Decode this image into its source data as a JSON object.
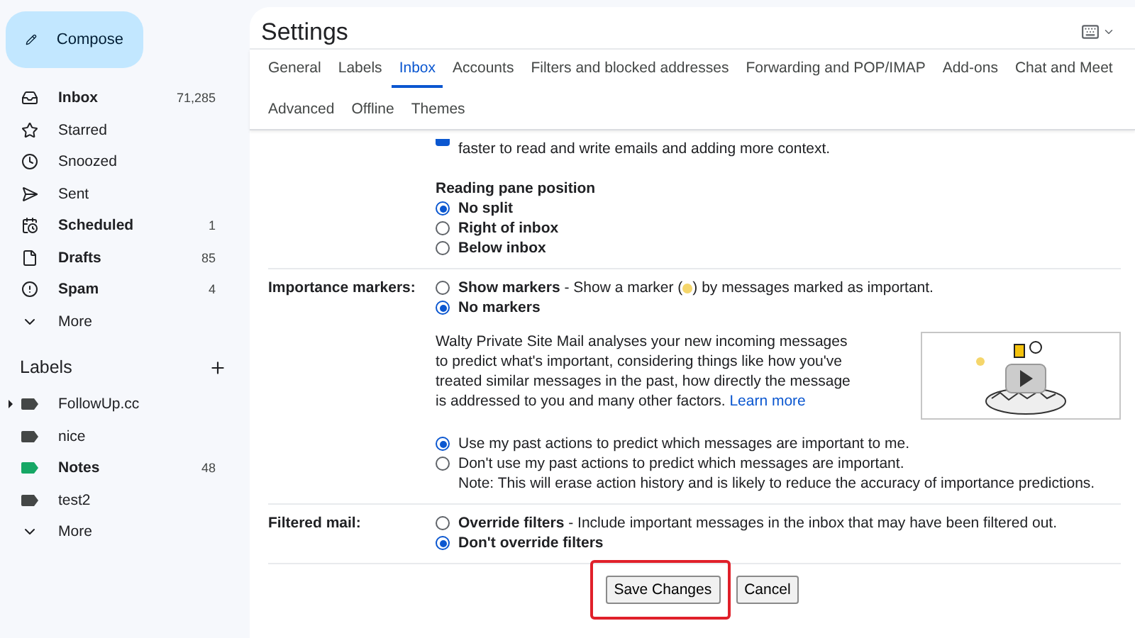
{
  "sidebar": {
    "compose": "Compose",
    "items": [
      {
        "label": "Inbox",
        "count": "71,285",
        "bold": true,
        "selected": false
      },
      {
        "label": "Starred",
        "bold": false,
        "selected": false
      },
      {
        "label": "Snoozed",
        "bold": false,
        "selected": false
      },
      {
        "label": "Sent",
        "bold": false,
        "selected": false
      },
      {
        "label": "Scheduled",
        "count": "1",
        "bold": true,
        "selected": false
      },
      {
        "label": "Drafts",
        "count": "85",
        "bold": true,
        "selected": false
      },
      {
        "label": "Spam",
        "count": "4",
        "bold": true,
        "selected": false
      },
      {
        "label": "More",
        "bold": false,
        "selected": false
      }
    ],
    "labels_title": "Labels",
    "labels": [
      {
        "name": "FollowUp.cc",
        "bold": false,
        "color": "#444746",
        "collapsed": true
      },
      {
        "name": "nice",
        "bold": false,
        "color": "#444746",
        "collapsed": false
      },
      {
        "name": "Notes",
        "count": "48",
        "bold": true,
        "color": "#16a765",
        "collapsed": false
      },
      {
        "name": "test2",
        "bold": false,
        "color": "#444746",
        "collapsed": false
      }
    ],
    "labels_more": "More"
  },
  "header": {
    "title": "Settings"
  },
  "tabs": [
    {
      "label": "General",
      "selected": false
    },
    {
      "label": "Labels",
      "selected": false
    },
    {
      "label": "Inbox",
      "selected": true
    },
    {
      "label": "Accounts",
      "selected": false
    },
    {
      "label": "Filters and blocked addresses",
      "selected": false
    },
    {
      "label": "Forwarding and POP/IMAP",
      "selected": false
    },
    {
      "label": "Add-ons",
      "selected": false
    },
    {
      "label": "Chat and Meet",
      "selected": false
    },
    {
      "label": "Advanced",
      "selected": false
    },
    {
      "label": "Offline",
      "selected": false
    },
    {
      "label": "Themes",
      "selected": false
    }
  ],
  "reading_pane": {
    "enabled": true,
    "text": "faster to read and write emails and adding more context.",
    "position_title": "Reading pane position",
    "positions": [
      {
        "label": "No split",
        "selected": true
      },
      {
        "label": "Right of inbox",
        "selected": false
      },
      {
        "label": "Below inbox",
        "selected": false
      }
    ]
  },
  "importance": {
    "label": "Importance markers:",
    "options": [
      {
        "label": "Show markers",
        "description": "- Show a marker (",
        "description_end": ") by messages marked as important.",
        "selected": false
      },
      {
        "label": "No markers",
        "selected": true
      }
    ],
    "explanation": "Walty Private Site Mail analyses your new incoming messages to predict what's important, considering things like how you've treated similar messages in the past, how directly the message is addressed to you and many other factors.",
    "link": "Learn more",
    "predictions": [
      {
        "label": "Use my past actions to predict which messages are important to me.",
        "selected": true
      },
      {
        "label": "Don't use my past actions to predict which messages are important.",
        "selected": false
      }
    ],
    "note": "Note: This will erase action history and is likely to reduce the accuracy of importance predictions."
  },
  "filtered": {
    "label": "Filtered mail:",
    "options": [
      {
        "label": "Override filters",
        "description": "- Include important messages in the inbox that may have been filtered out.",
        "selected": false
      },
      {
        "label": "Don't override filters",
        "selected": true
      }
    ]
  },
  "buttons": [
    {
      "label": "Save Changes",
      "highlighted": true
    },
    {
      "label": "Cancel",
      "highlighted": false
    }
  ]
}
